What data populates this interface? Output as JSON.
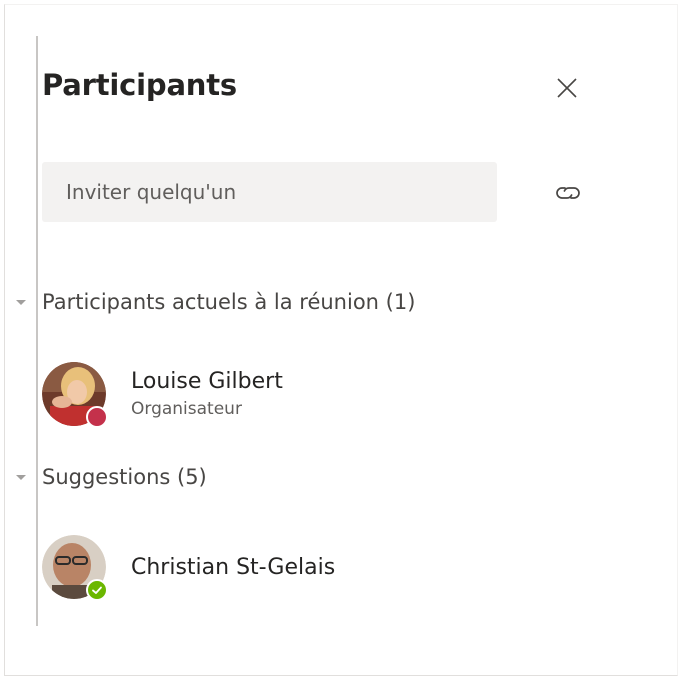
{
  "panel": {
    "title": "Participants",
    "close_icon": "close-icon",
    "search": {
      "placeholder": "Inviter quelqu'un",
      "value": ""
    },
    "copy_link_icon": "link-icon"
  },
  "sections": [
    {
      "label": "Participants actuels à la réunion (1)",
      "expanded": true,
      "people": [
        {
          "name": "Louise Gilbert",
          "role": "Organisateur",
          "presence": "busy",
          "presence_color": "#c4314b"
        }
      ]
    },
    {
      "label": "Suggestions (5)",
      "expanded": true,
      "people": [
        {
          "name": "Christian St-Gelais",
          "role": "",
          "presence": "available",
          "presence_color": "#6bb700"
        }
      ]
    }
  ],
  "colors": {
    "text_primary": "#252423",
    "text_secondary": "#605e5c",
    "search_bg": "#f3f2f1"
  }
}
